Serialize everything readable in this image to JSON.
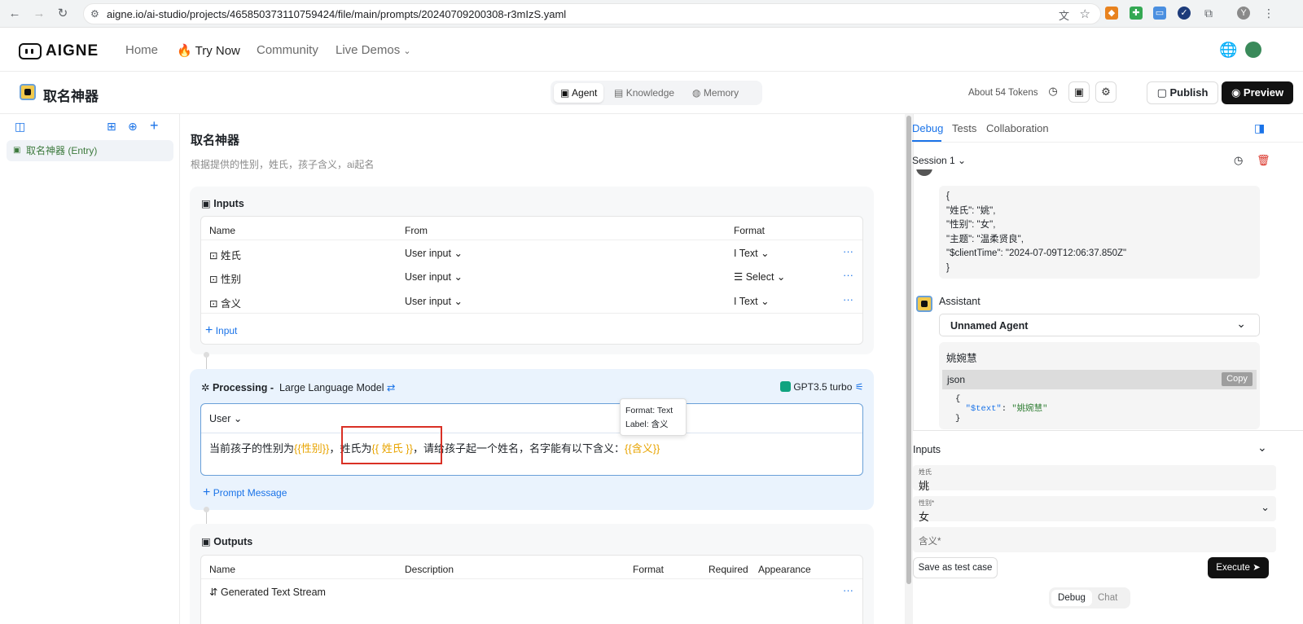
{
  "browser": {
    "url": "aigne.io/ai-studio/projects/465850373110759424/file/main/prompts/20240709200308-r3mIzS.yaml",
    "profile_initial": "Y"
  },
  "nav": {
    "logo": "AIGNE",
    "home": "Home",
    "try_now": "Try Now",
    "community": "Community",
    "live_demos": "Live Demos"
  },
  "project": {
    "name": "取名神器",
    "tabs": [
      "Agent",
      "Knowledge",
      "Memory"
    ],
    "tokens": "About 54 Tokens",
    "publish": "Publish",
    "preview": "Preview"
  },
  "sidebar": {
    "entry": "取名神器 (Entry)"
  },
  "agent": {
    "title": "取名神器",
    "description": "根据提供的性别，姓氏，孩子含义，ai起名"
  },
  "inputs_section": {
    "title": "Inputs",
    "headers": [
      "Name",
      "From",
      "Format"
    ],
    "rows": [
      {
        "name": "姓氏",
        "from": "User input",
        "format": "Text"
      },
      {
        "name": "性别",
        "from": "User input",
        "format": "Select"
      },
      {
        "name": "含义",
        "from": "User input",
        "format": "Text"
      }
    ],
    "add": "Input"
  },
  "processing": {
    "title": "Processing -",
    "model_type": "Large Language Model",
    "model": "GPT3.5 turbo",
    "role": "User",
    "prompt_parts": [
      "当前孩子的性别为",
      "{{性别}}",
      "，姓氏为",
      "{{ 姓氏 }}",
      "，请给孩子起一个姓名，名字能有以下含义：",
      "{{含义}}"
    ],
    "tooltip_format": "Format: Text",
    "tooltip_label": "Label: 含义",
    "add_prompt": "Prompt Message"
  },
  "outputs_section": {
    "title": "Outputs",
    "headers": [
      "Name",
      "Description",
      "Format",
      "Required",
      "Appearance"
    ],
    "rows": [
      {
        "name": "Generated Text Stream"
      }
    ]
  },
  "debug": {
    "tabs": [
      "Debug",
      "Tests",
      "Collaboration"
    ],
    "session": "Session 1",
    "user_message_lines": [
      "{",
      "\"姓氏\": \"姚\",",
      "\"性别\": \"女\",",
      "\"主题\": \"温柔贤良\",",
      "\"$clientTime\": \"2024-07-09T12:06:37.850Z\"",
      "}"
    ],
    "assistant_label": "Assistant",
    "agent_select": "Unnamed Agent",
    "reply": "姚婉慧",
    "code_lang": "json",
    "copy": "Copy",
    "code_lines": [
      "{",
      "\"$text\": \"姚婉慧\"",
      "}"
    ],
    "code_key": "\"$text\"",
    "code_value": "\"姚婉慧\"",
    "inputs_title": "Inputs",
    "fields": [
      {
        "label": "姓氏",
        "value": "姚"
      },
      {
        "label": "性别*",
        "value": "女"
      },
      {
        "label": "含义*",
        "value": ""
      }
    ],
    "save_test": "Save as test case",
    "execute": "Execute",
    "mode_tabs": [
      "Debug",
      "Chat"
    ]
  },
  "colors": {
    "accent": "#1a73e8",
    "variable": "#e8a400",
    "highlight_border": "#d93025",
    "entry_green": "#3d7a3d"
  }
}
